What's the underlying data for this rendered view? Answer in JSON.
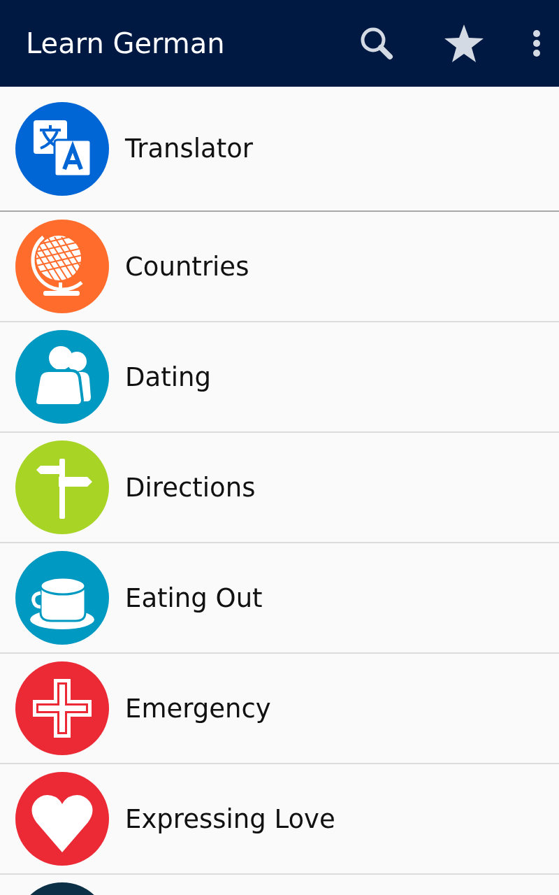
{
  "app_bar": {
    "title": "Learn German",
    "actions": [
      {
        "kind": "search"
      },
      {
        "kind": "favorites"
      },
      {
        "kind": "more"
      }
    ]
  },
  "featured": {
    "label": "Translator",
    "color": "#0066d6"
  },
  "categories": [
    {
      "label": "Countries",
      "color": "#ff6c2c"
    },
    {
      "label": "Dating",
      "color": "#0099c2"
    },
    {
      "label": "Directions",
      "color": "#a8d425"
    },
    {
      "label": "Eating Out",
      "color": "#0099c2"
    },
    {
      "label": "Emergency",
      "color": "#ec2a35"
    },
    {
      "label": "Expressing Love",
      "color": "#ec2a35"
    },
    {
      "color": "#0c3045"
    }
  ]
}
